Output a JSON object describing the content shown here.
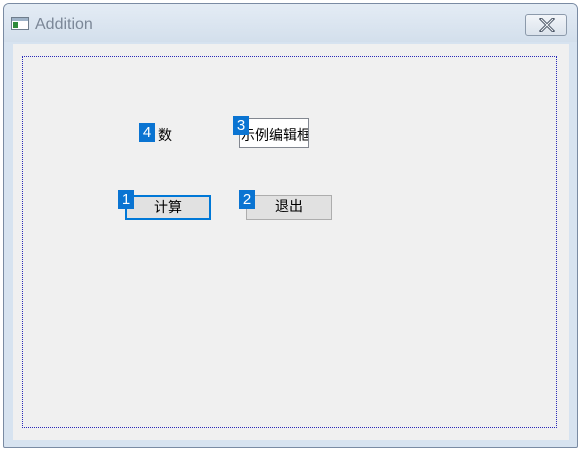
{
  "window": {
    "title": "Addition"
  },
  "form": {
    "number_label": "数",
    "edit_value": "示例编辑框",
    "calc_button": "计算",
    "exit_button": "退出"
  },
  "badges": {
    "calc": "1",
    "exit": "2",
    "edit": "3",
    "label": "4"
  },
  "colors": {
    "badge": "#0a74d2",
    "focus_border": "#0078d7",
    "client_background": "#f0f0f0",
    "title_text": "#7b8797"
  },
  "icons": {
    "app": "window-app-icon",
    "close": "close-icon"
  }
}
